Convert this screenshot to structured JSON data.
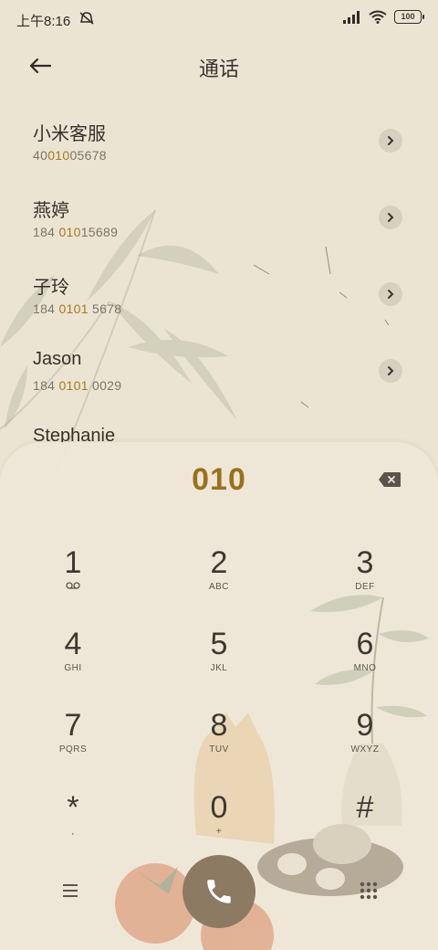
{
  "status_bar": {
    "time": "上午8:16",
    "battery": "100"
  },
  "header": {
    "title": "通话"
  },
  "results": [
    {
      "name": "小米客服",
      "num_pre": "40",
      "num_hl": "010",
      "num_post": "05678"
    },
    {
      "name": "燕婷",
      "num_pre": "184 ",
      "num_hl": "010",
      "num_post": "15689"
    },
    {
      "name": "子玲",
      "num_pre": "184 ",
      "num_hl": "0101",
      "num_post": " 5678"
    },
    {
      "name": "Jason",
      "num_pre": "184 ",
      "num_hl": "0101",
      "num_post": " 0029"
    },
    {
      "name": "Stephanie",
      "num_pre": "",
      "num_hl": "",
      "num_post": ""
    }
  ],
  "dialer": {
    "number": "010",
    "keys": [
      {
        "num": "1",
        "sub": ""
      },
      {
        "num": "2",
        "sub": "ABC"
      },
      {
        "num": "3",
        "sub": "DEF"
      },
      {
        "num": "4",
        "sub": "GHI"
      },
      {
        "num": "5",
        "sub": "JKL"
      },
      {
        "num": "6",
        "sub": "MNO"
      },
      {
        "num": "7",
        "sub": "PQRS"
      },
      {
        "num": "8",
        "sub": "TUV"
      },
      {
        "num": "9",
        "sub": "WXYZ"
      },
      {
        "num": "*",
        "sub": ","
      },
      {
        "num": "0",
        "sub": "+"
      },
      {
        "num": "#",
        "sub": ""
      }
    ]
  },
  "icons": {
    "back": "arrow-left-icon",
    "chevron": "chevron-right-icon",
    "delete": "backspace-icon",
    "voicemail": "voicemail-icon",
    "menu": "menu-icon",
    "call": "phone-icon",
    "keypad": "keypad-icon"
  },
  "colors": {
    "background": "#ece4d2",
    "highlight": "#a57a22",
    "call_button": "#8d7a63"
  }
}
